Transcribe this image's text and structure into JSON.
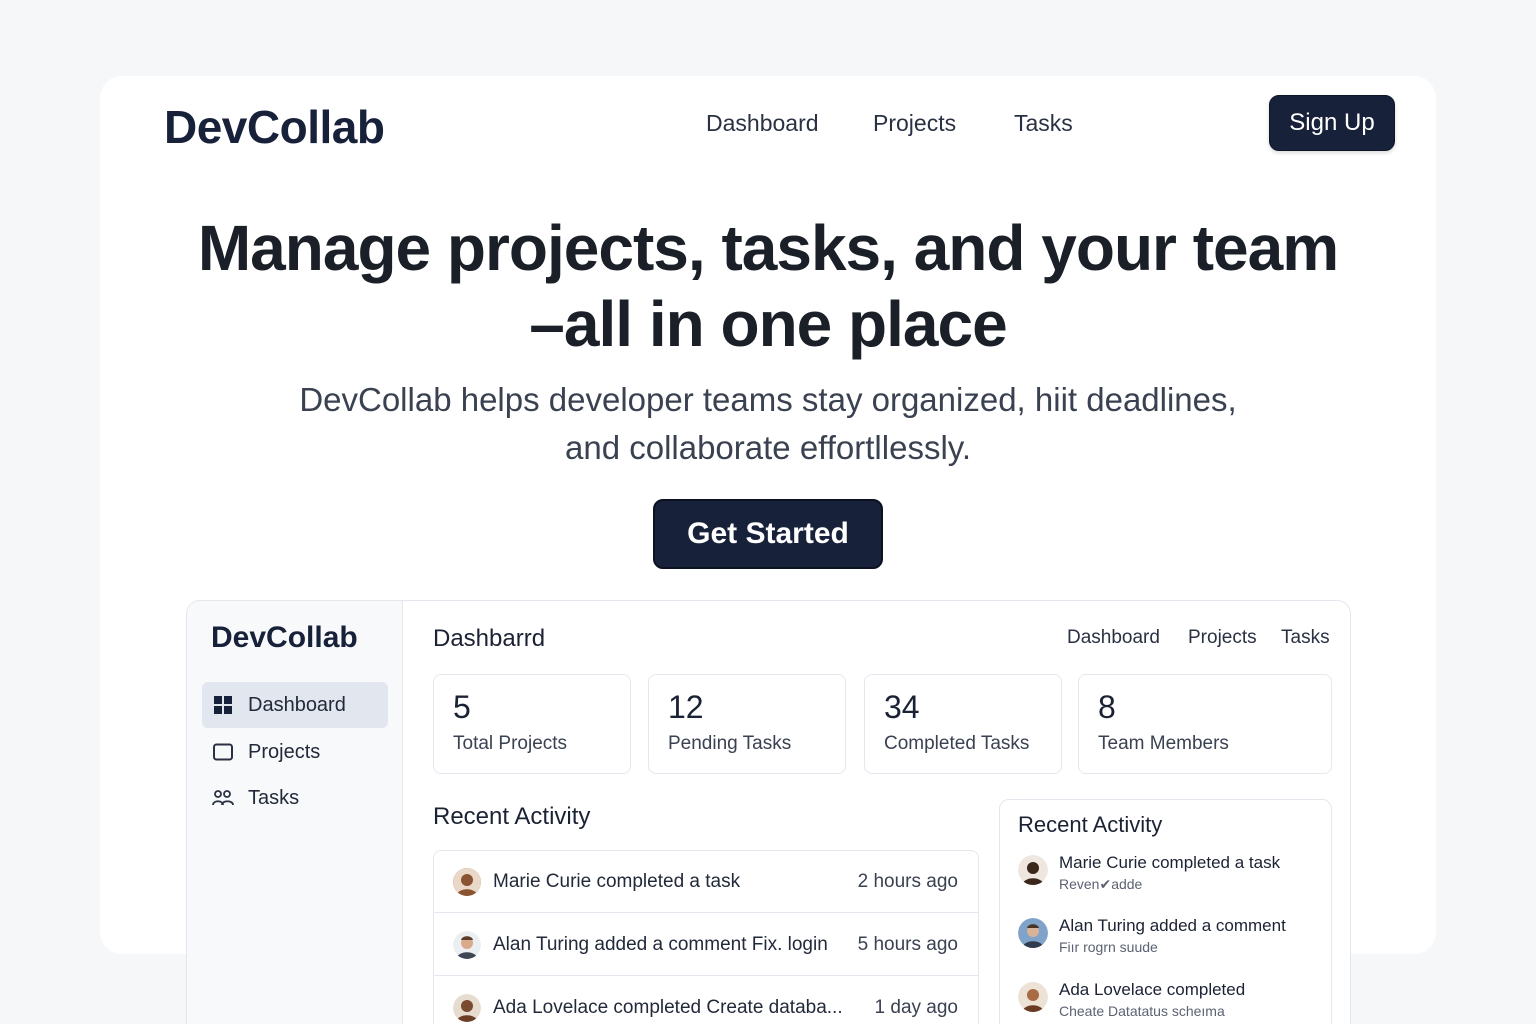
{
  "header": {
    "logo": "DevCollab",
    "nav": [
      "Dashboard",
      "Projects",
      "Tasks"
    ],
    "signup_label": "Sign Up"
  },
  "hero": {
    "title_line1": "Manage projects, tasks, and your team",
    "title_line2": "–all in one place",
    "subtitle_line1": "DevCollab helps developer teams stay organized, hiit deadlines,",
    "subtitle_line2": "and collaborate effortllessly.",
    "cta_label": "Get Started"
  },
  "preview": {
    "sidebar": {
      "logo": "DevCollab",
      "items": [
        {
          "label": "Dashboard",
          "icon": "grid-icon",
          "active": true
        },
        {
          "label": "Projects",
          "icon": "folder-icon",
          "active": false
        },
        {
          "label": "Tasks",
          "icon": "people-icon",
          "active": false
        }
      ]
    },
    "title": "Dashbarrd",
    "nav": [
      "Dashboard",
      "Projects",
      "Tasks"
    ],
    "stats": [
      {
        "value": "5",
        "label": "Total Projects"
      },
      {
        "value": "12",
        "label": "Pending Tasks"
      },
      {
        "value": "34",
        "label": "Completed Tasks"
      },
      {
        "value": "8",
        "label": "Team Members"
      }
    ],
    "recent_title": "Recent Activity",
    "activity": [
      {
        "text": "Marie Curie  completed  a task",
        "time": "2 hours ago"
      },
      {
        "text": "Alan Turing  added a comment  Fix. login",
        "time": "5 hours ago"
      },
      {
        "text": "Ada Lovelace  completed Create databa...",
        "time": "1 day ago"
      }
    ],
    "side_card": {
      "title": "Recent Activity",
      "items": [
        {
          "line1": "Marie Curie completed a task",
          "line2": "Reven✔adde"
        },
        {
          "line1": "Alan Turing added a comment",
          "line2": "Fiır rogrn suude"
        },
        {
          "line1": "Ada Lovelace completed",
          "line2": "Cheate Datatatus scheıma"
        }
      ]
    }
  },
  "colors": {
    "brand_navy": "#18213a",
    "page_bg": "#f6f7f9",
    "card_bg": "#ffffff",
    "text": "#1b2233"
  }
}
